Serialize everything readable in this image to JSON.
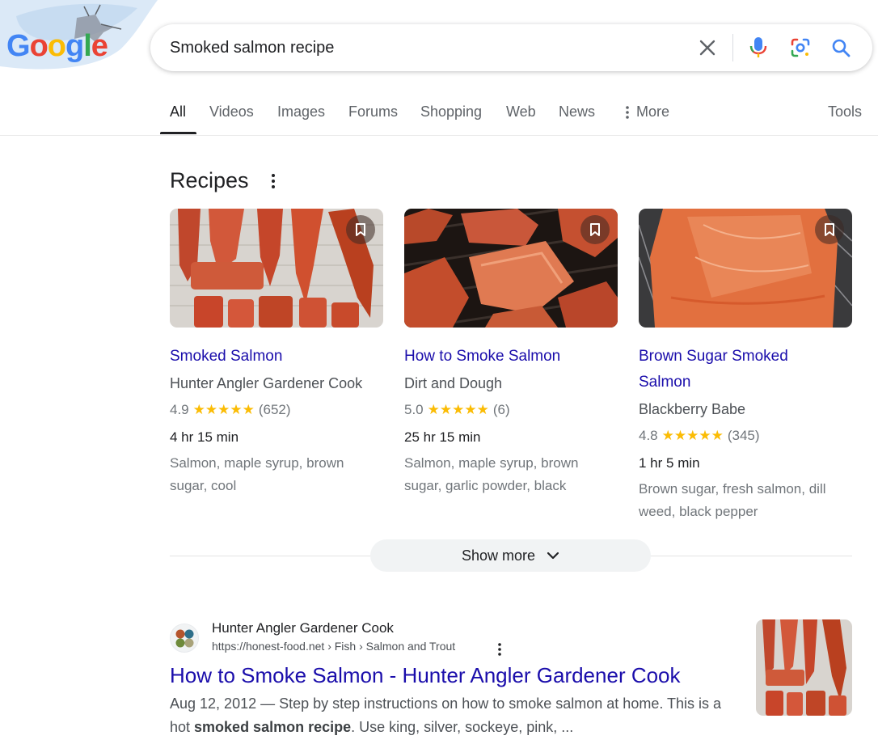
{
  "logo": {
    "text": "Google"
  },
  "search": {
    "query": "Smoked salmon recipe"
  },
  "tabs": [
    {
      "label": "All"
    },
    {
      "label": "Videos"
    },
    {
      "label": "Images"
    },
    {
      "label": "Forums"
    },
    {
      "label": "Shopping"
    },
    {
      "label": "Web"
    },
    {
      "label": "News"
    },
    {
      "label": "More"
    }
  ],
  "tools_label": "Tools",
  "recipes": {
    "heading": "Recipes",
    "cards": [
      {
        "title_lines": [
          "Smoked Salmon"
        ],
        "source": "Hunter Angler Gardener Cook",
        "rating": "4.9",
        "stars": 5,
        "review_count": "(652)",
        "time": "4 hr 15 min",
        "ingredients_lines": [
          "Salmon, maple syrup, brown",
          "sugar, cool"
        ]
      },
      {
        "title_lines": [
          "How to Smoke Salmon"
        ],
        "source": "Dirt and Dough",
        "rating": "5.0",
        "stars": 5,
        "review_count": "(6)",
        "time": "25 hr 15 min",
        "ingredients_lines": [
          "Salmon, maple syrup, brown",
          "sugar, garlic powder, black"
        ]
      },
      {
        "title_lines": [
          "Brown Sugar Smoked",
          "Salmon"
        ],
        "source": "Blackberry Babe",
        "rating": "4.8",
        "stars": 5,
        "review_count": "(345)",
        "time": "1 hr 5 min",
        "ingredients_lines": [
          "Brown sugar, fresh salmon, dill",
          "weed, black pepper"
        ]
      }
    ],
    "show_more_label": "Show more"
  },
  "result": {
    "site_name": "Hunter Angler Gardener Cook",
    "url": "https://honest-food.net › Fish › Salmon and Trout",
    "title": "How to Smoke Salmon - Hunter Angler Gardener Cook",
    "snippet_line1": "Aug 12, 2012 — Step by step instructions on how to smoke salmon at home. This is a",
    "snippet_pre": "hot ",
    "snippet_bold": "smoked salmon recipe",
    "snippet_post": ". Use king, silver, sockeye, pink, ..."
  },
  "colors": {
    "link": "#1a0dab",
    "star": "#fbbc04",
    "mic_blue": "#4285f4",
    "mic_red": "#ea4335"
  }
}
